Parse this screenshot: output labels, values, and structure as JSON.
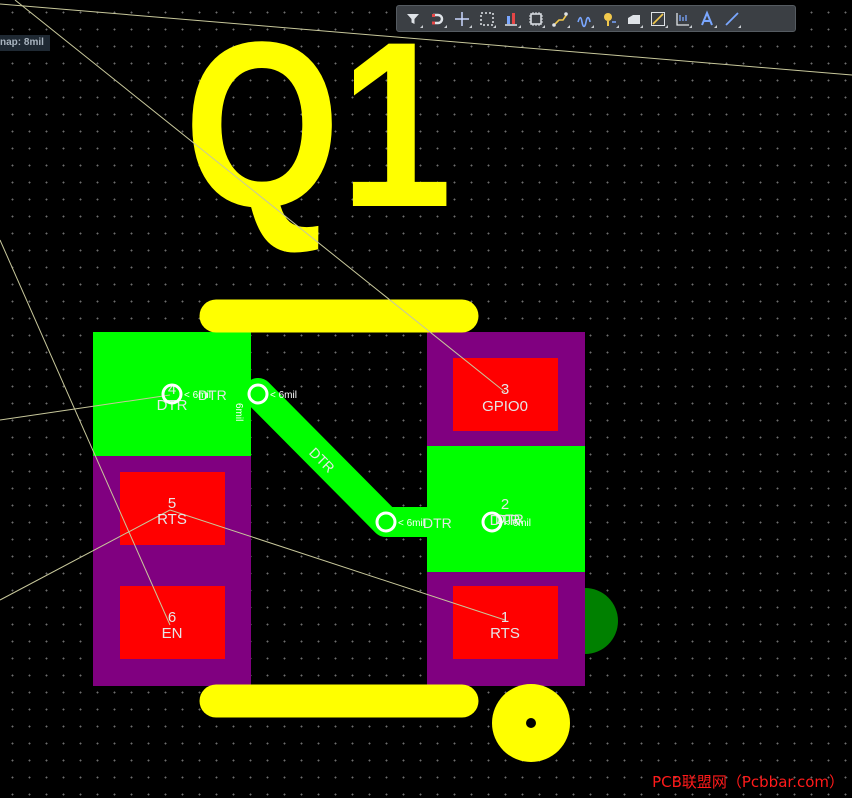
{
  "snap_label": "nap: 8mil",
  "designator": "Q1",
  "toolbar": {
    "items": [
      {
        "name": "filter-icon"
      },
      {
        "name": "magnet-icon"
      },
      {
        "name": "crosshair-icon"
      },
      {
        "name": "select-rect-icon"
      },
      {
        "name": "align-icon"
      },
      {
        "name": "component-icon"
      },
      {
        "name": "route-icon"
      },
      {
        "name": "diff-pair-icon"
      },
      {
        "name": "tune-length-icon"
      },
      {
        "name": "polygon-pour-icon"
      },
      {
        "name": "via-stitch-icon"
      },
      {
        "name": "dimension-icon"
      },
      {
        "name": "text-icon"
      },
      {
        "name": "line-icon"
      }
    ]
  },
  "pads": [
    {
      "number": "3",
      "net": "GPIO0"
    },
    {
      "number": "2",
      "net": "DTR"
    },
    {
      "number": "1",
      "net": "RTS"
    },
    {
      "number": "4",
      "net": "DTR"
    },
    {
      "number": "5",
      "net": "RTS"
    },
    {
      "number": "6",
      "net": "EN"
    }
  ],
  "track": {
    "net": "DTR"
  },
  "clearance_labels": [
    "< 6mil",
    "< 6mil",
    "< 6mil",
    "< 6mil",
    "6mil"
  ],
  "net_labels": [
    "DTR",
    "DTR",
    "DTR"
  ],
  "colors": {
    "silkscreen": "#ffff00",
    "copper_net": "#00ff00",
    "pad": "#ff0000",
    "pad_mask": "#800080",
    "ratsnest": "#c8c89b"
  },
  "footer_text": "PCB联盟网（Pcbbar.com）"
}
